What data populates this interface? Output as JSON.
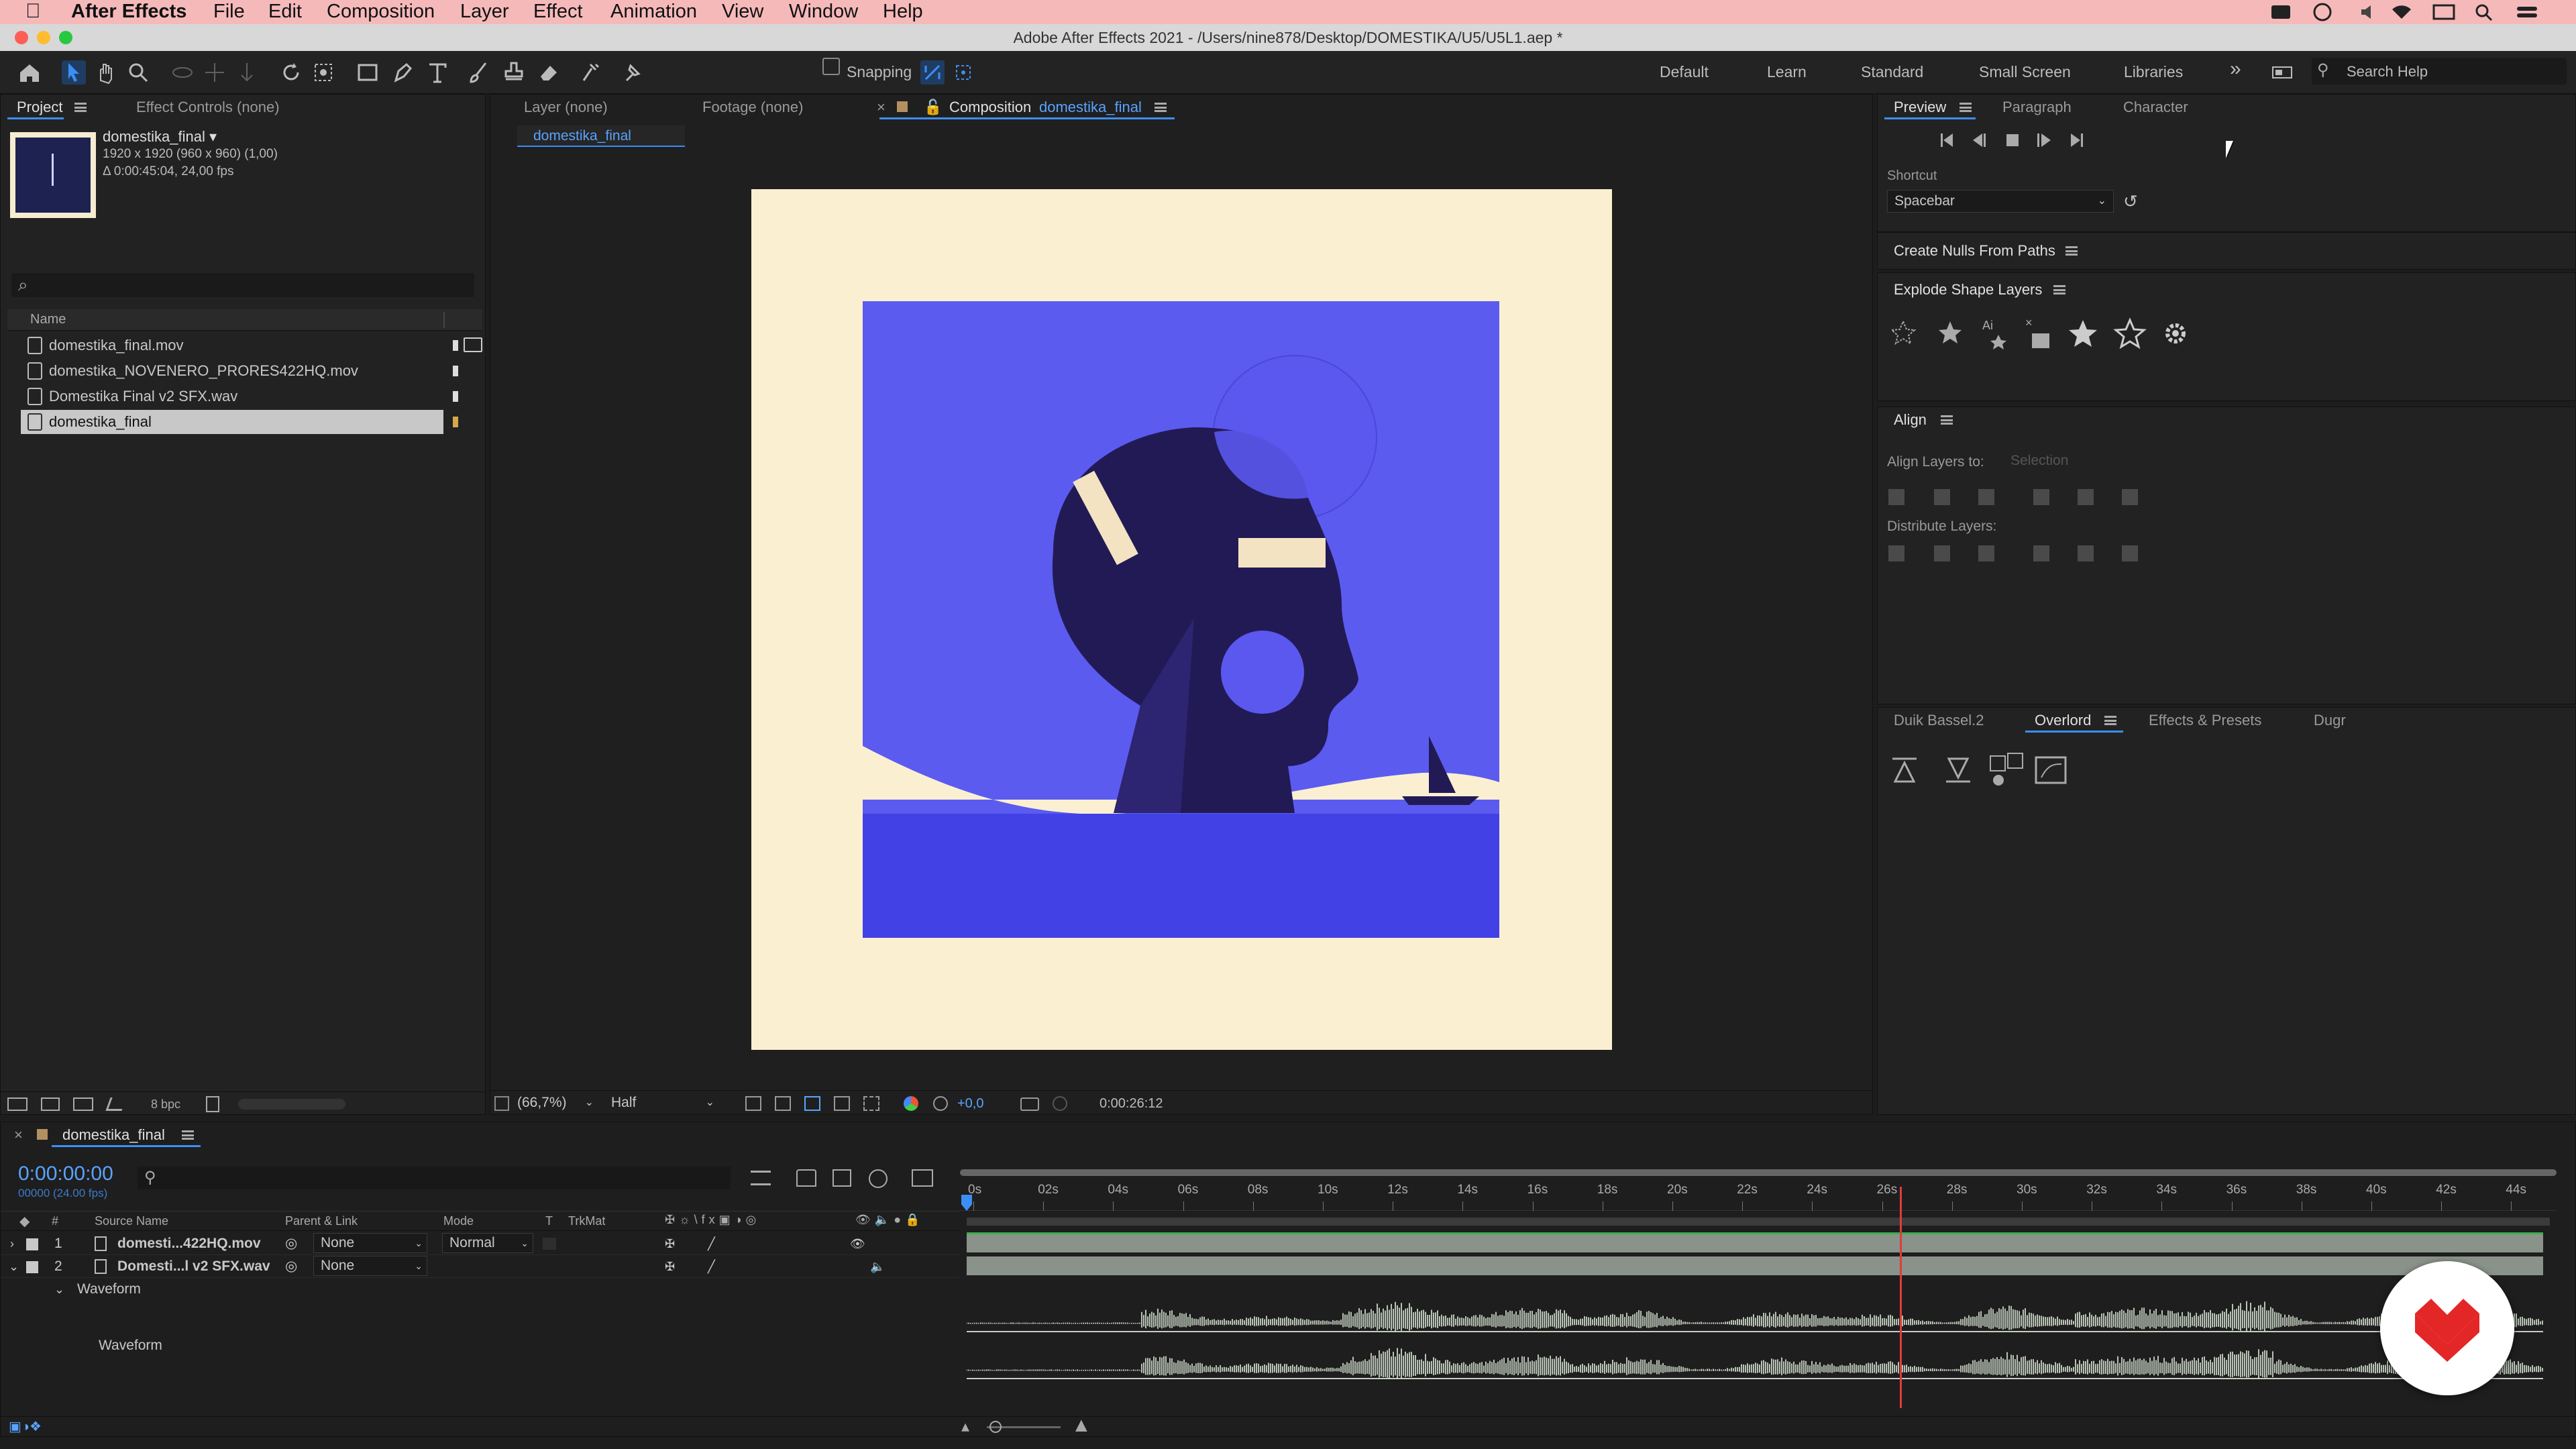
{
  "menubar": {
    "app": "After Effects",
    "items": [
      "File",
      "Edit",
      "Composition",
      "Layer",
      "Effect",
      "Animation",
      "View",
      "Window",
      "Help"
    ]
  },
  "titlebar": {
    "title": "Adobe After Effects 2021 - /Users/nine878/Desktop/DOMESTIKA/U5/U5L1.aep *"
  },
  "toolbar": {
    "snapping": "Snapping",
    "workspaces": [
      "Default",
      "Learn",
      "Standard",
      "Small Screen",
      "Libraries"
    ],
    "more": "»",
    "search_placeholder": "Search Help"
  },
  "project_panel": {
    "tabs": [
      "Project",
      "Effect Controls (none)"
    ],
    "selected_name": "domestika_final ▾",
    "info_line1": "1920 x 1920  (960 x 960) (1,00)",
    "info_line2": "Δ 0:00:45:04, 24,00 fps",
    "search_icon": "⌕",
    "column_name": "Name",
    "items": [
      {
        "name": "domestika_final.mov",
        "selected": false
      },
      {
        "name": "domestika_NOVENERO_PRORES422HQ.mov",
        "selected": false
      },
      {
        "name": "Domestika Final v2 SFX.wav",
        "selected": false
      },
      {
        "name": "domestika_final",
        "selected": true
      }
    ],
    "bpc": "8 bpc"
  },
  "viewer": {
    "tabs": [
      "Layer (none)",
      "Footage (none)"
    ],
    "comp_tab_prefix": "Composition",
    "comp_tab_name": "domestika_final",
    "breadcrumb": "domestika_final",
    "zoom": "(66,7%)",
    "resolution": "Half",
    "exposure": "+0,0",
    "timecode": "0:00:26:12",
    "colors": {
      "bg": "#fbefd2",
      "sky": "#5b5bf0",
      "sea": "#4141e6",
      "dark": "#221a55",
      "light_circle": "#5a58ee"
    }
  },
  "right_panel": {
    "tabs": [
      "Preview",
      "Paragraph",
      "Character"
    ],
    "shortcut_label": "Shortcut",
    "shortcut_value": "Spacebar",
    "create_nulls": "Create Nulls From Paths",
    "explode": "Explode Shape Layers",
    "align": "Align",
    "align_layers_to": "Align Layers to:",
    "align_selection": "Selection",
    "distribute": "Distribute Layers:",
    "bottom_tabs": [
      "Duik Bassel.2",
      "Overlord",
      "Effects & Presets",
      "Dugr"
    ]
  },
  "timeline": {
    "tab": "domestika_final",
    "current_time": "0:00:00:00",
    "frames": "00000 (24.00 fps)",
    "columns": {
      "num": "#",
      "source": "Source Name",
      "parent": "Parent & Link",
      "mode": "Mode",
      "t": "T",
      "trkmat": "TrkMat"
    },
    "layers": [
      {
        "num": "1",
        "name": "domesti...422HQ.mov",
        "parent": "None",
        "mode": "Normal"
      },
      {
        "num": "2",
        "name": "Domesti...l v2 SFX.wav",
        "parent": "None",
        "mode": ""
      }
    ],
    "waveform_group": "Waveform",
    "waveform_label": "Waveform",
    "ruler": [
      "0s",
      "02s",
      "04s",
      "06s",
      "08s",
      "10s",
      "12s",
      "14s",
      "16s",
      "18s",
      "20s",
      "22s",
      "24s",
      "26s",
      "28s",
      "30s",
      "32s",
      "34s",
      "36s",
      "38s",
      "40s",
      "42s",
      "44s"
    ],
    "playhead_seconds": 26.5,
    "duration_seconds": 45.17
  }
}
